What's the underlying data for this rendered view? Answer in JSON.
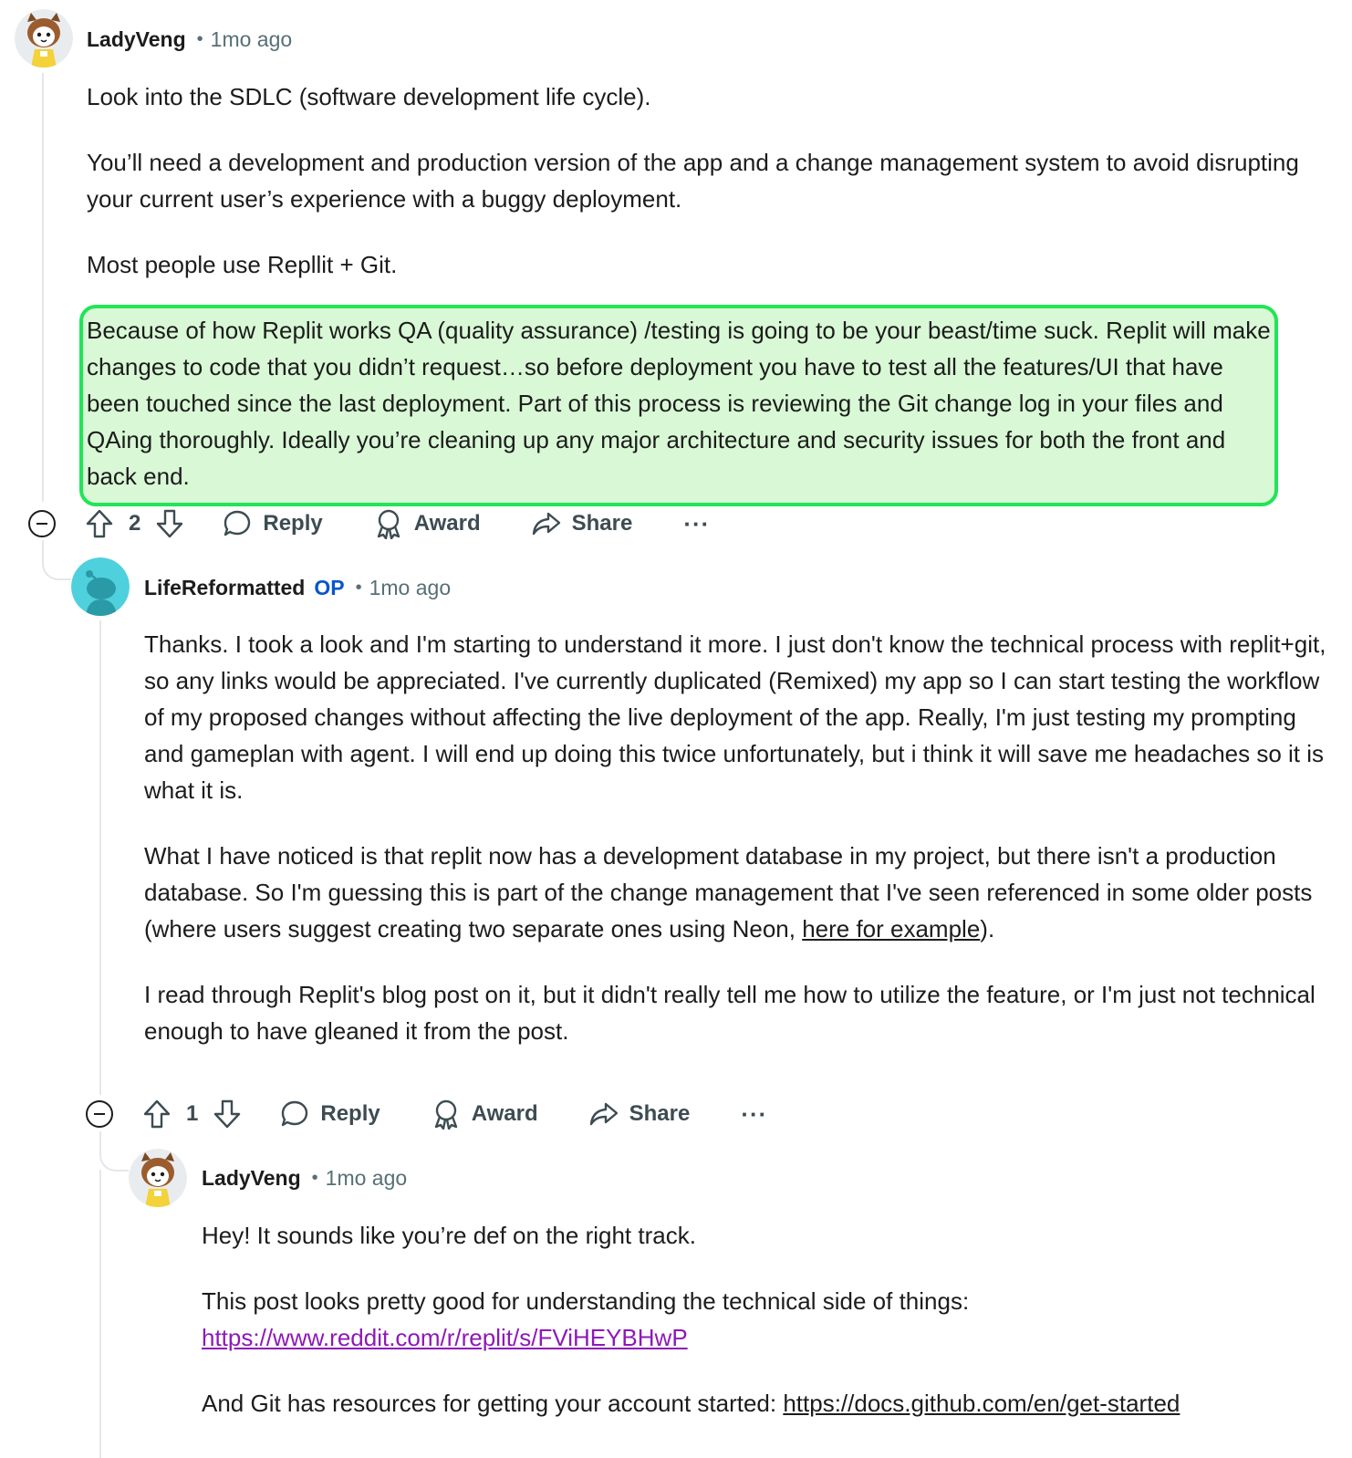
{
  "comments": [
    {
      "author": "LadyVeng",
      "time": "1mo ago",
      "paragraphs": [
        "Look into the SDLC (software development life cycle).",
        "You’ll need a development and production version of the app and a change management system to avoid disrupting your current user’s experience with a buggy deployment.",
        "Most people use Repllit + Git."
      ],
      "highlight": "Because of how Replit works QA (quality assurance) /testing is going to be your beast/time suck. Replit will make changes to code that you didn’t request…so before deployment you have to test all the features/UI that have been touched since the last deployment. Part of this process is reviewing the Git change log in your files and QAing thoroughly. Ideally you’re cleaning up any major architecture and security issues for both the front and back end.",
      "votes": "2"
    },
    {
      "author": "LifeReformatted",
      "op": "OP",
      "time": "1mo ago",
      "p1": "Thanks. I took a look and I'm starting to understand it more. I just don't know the technical process with replit+git, so any links would be appreciated. I've currently duplicated (Remixed) my app so I can start testing the workflow of my proposed changes without affecting the live deployment of the app. Really, I'm just testing my prompting and gameplan with agent. I will end up doing this twice unfortunately, but i think it will save me headaches so it is what it is.",
      "p2_before": "What I have noticed is that replit now has a development database in my project, but there isn't a production database. So I'm guessing this is part of the change management that I've seen referenced in some older posts (where users suggest creating two separate ones using Neon, ",
      "p2_link": "here for example",
      "p2_after": ").",
      "p3": "I read through Replit's blog post on it, but it didn't really tell me how to utilize the feature, or I'm just not technical enough to have gleaned it from the post.",
      "votes": "1"
    },
    {
      "author": "LadyVeng",
      "time": "1mo ago",
      "p1": "Hey! It sounds like you’re def on the right track.",
      "p2": "This post looks pretty good for understanding the technical side of things:",
      "p2_link": "https://www.reddit.com/r/replit/s/FViHEYBHwP",
      "p3_before": "And Git has resources for getting your account started: ",
      "p3_link": "https://docs.github.com/en/get-started"
    }
  ],
  "actions": {
    "reply": "Reply",
    "award": "Award",
    "share": "Share",
    "more": "···"
  },
  "colors": {
    "highlight_border": "#22e457",
    "highlight_fill": "#d9f9d6",
    "op_badge": "#0a55c9",
    "visited_link": "#8e18b8",
    "meta_text": "#576f76"
  }
}
